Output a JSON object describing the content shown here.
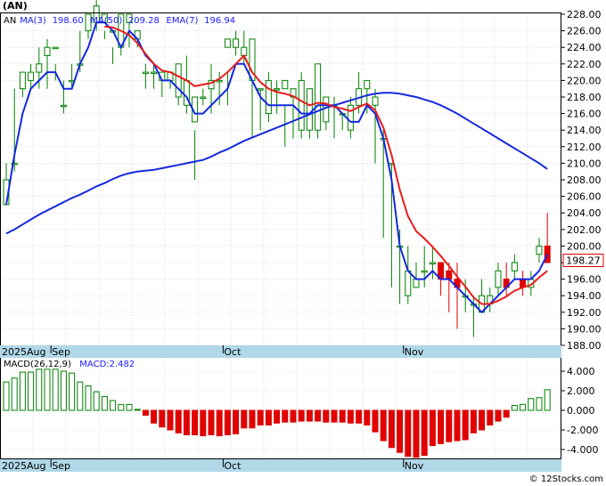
{
  "header": {
    "title": "(AN)",
    "legend": [
      {
        "label": "AN",
        "color": "#000000"
      },
      {
        "label": "MA(3)",
        "color": "#1a1aff"
      },
      {
        "label": "198.60",
        "color": "#1a1aff"
      },
      {
        "label": "MA(50)",
        "color": "#1a1aff"
      },
      {
        "label": "209.28",
        "color": "#1a1aff"
      },
      {
        "label": "EMA(7)",
        "color": "#1a1aff"
      },
      {
        "label": "196.94",
        "color": "#1a1aff"
      }
    ]
  },
  "macd_header": {
    "legend": [
      {
        "label": "MACD(26,12,9)",
        "color": "#000000"
      },
      {
        "label": "MACD:2.482",
        "color": "#1a1aff"
      }
    ]
  },
  "footer": {
    "credit": "© 12Stocks.com"
  },
  "colors": {
    "background": "#ffffff",
    "grid": "#c8c8c8",
    "up": "#008000",
    "down": "#e00000",
    "ma_line": "#1428e0",
    "ema_line": "#e81c1c",
    "axis_band": "#b0d8e8",
    "price_tag_border": "#e00000"
  },
  "chart_data": [
    {
      "type": "candlestick",
      "title": "(AN)",
      "ylim": [
        187,
        230
      ],
      "yticks": [
        188,
        190,
        192,
        194,
        196,
        198,
        200,
        202,
        204,
        206,
        208,
        210,
        212,
        214,
        216,
        218,
        220,
        222,
        224,
        226,
        228
      ],
      "ytick_labels": [
        "188.00",
        "190.00",
        "192.00",
        "194.00",
        "196.00",
        "198.00",
        "200.00",
        "202.00",
        "204.00",
        "206.00",
        "208.00",
        "210.00",
        "212.00",
        "214.00",
        "216.00",
        "218.00",
        "220.00",
        "222.00",
        "224.00",
        "226.00",
        "228.00"
      ],
      "x_labels": [
        {
          "label": "2025Aug",
          "index": 0
        },
        {
          "label": "Sep",
          "index": 6
        },
        {
          "label": "Oct",
          "index": 27
        },
        {
          "label": "Nov",
          "index": 49
        }
      ],
      "last_price": "198.27",
      "ohlc": [
        [
          205,
          208,
          207,
          210
        ],
        [
          210,
          210,
          209,
          219
        ],
        [
          219,
          221,
          218,
          221
        ],
        [
          220,
          221,
          219,
          222
        ],
        [
          221,
          222,
          219,
          224
        ],
        [
          223,
          224,
          219,
          225
        ],
        [
          224,
          224,
          220,
          222
        ],
        [
          217,
          217,
          216,
          220
        ],
        [
          220,
          220,
          219,
          222
        ],
        [
          222,
          222,
          221,
          226
        ],
        [
          226,
          228,
          225,
          228
        ],
        [
          227,
          229,
          226,
          230
        ],
        [
          227,
          228,
          225,
          226
        ],
        [
          226,
          226,
          222,
          224
        ],
        [
          224,
          228,
          223,
          225
        ],
        [
          227,
          228,
          224,
          228
        ],
        [
          225,
          226,
          224,
          226
        ],
        [
          221,
          221,
          219,
          222
        ],
        [
          221,
          221,
          219,
          222
        ],
        [
          220,
          221,
          218,
          221
        ],
        [
          220,
          221,
          219,
          221
        ],
        [
          218,
          222,
          217,
          221
        ],
        [
          217,
          220,
          216,
          223
        ],
        [
          215,
          218,
          208,
          214
        ],
        [
          218,
          218,
          217,
          219
        ],
        [
          219,
          220,
          216,
          222
        ],
        [
          220,
          220,
          217,
          221
        ],
        [
          224,
          225,
          217,
          221
        ],
        [
          224,
          225,
          223,
          226
        ],
        [
          223,
          224,
          222,
          226
        ],
        [
          220,
          225,
          213,
          220
        ],
        [
          219,
          219,
          214,
          219
        ],
        [
          216,
          220,
          215,
          221
        ],
        [
          219,
          219,
          216,
          220
        ],
        [
          219,
          220,
          212,
          217
        ],
        [
          218,
          219,
          213,
          219
        ],
        [
          214,
          220,
          213,
          221
        ],
        [
          214,
          219,
          213,
          219
        ],
        [
          214,
          222,
          213,
          222
        ],
        [
          215,
          218,
          214,
          217
        ],
        [
          217,
          217,
          213,
          218
        ],
        [
          216,
          216,
          214,
          216
        ],
        [
          214,
          217,
          213,
          218
        ],
        [
          217,
          219,
          216,
          221
        ],
        [
          219,
          220,
          216,
          220
        ],
        [
          217,
          218,
          210,
          219
        ],
        [
          213,
          213,
          201,
          214
        ],
        [
          210,
          210,
          195,
          210
        ],
        [
          200,
          200,
          193,
          202
        ],
        [
          194,
          197,
          193,
          200
        ],
        [
          195,
          196,
          195,
          198
        ],
        [
          197,
          197,
          195,
          200
        ],
        [
          198,
          198,
          196,
          200
        ],
        [
          198,
          196,
          194,
          198
        ],
        [
          197,
          196,
          192,
          198
        ],
        [
          196,
          195,
          190,
          198
        ],
        [
          194,
          194,
          192,
          196
        ],
        [
          193,
          193,
          189,
          194
        ],
        [
          192,
          194,
          192,
          196
        ],
        [
          193,
          194,
          192,
          195
        ],
        [
          195,
          197,
          194,
          198
        ],
        [
          196,
          195,
          194,
          198
        ],
        [
          197,
          198,
          196,
          199
        ],
        [
          196,
          195,
          194,
          197
        ],
        [
          195,
          196,
          194,
          197
        ],
        [
          199,
          200,
          198,
          201
        ],
        [
          200,
          198,
          198,
          204
        ]
      ],
      "series": [
        {
          "name": "MA(3)",
          "color": "#1428e0",
          "values": [
            205,
            211,
            216,
            219,
            220,
            221,
            221,
            219,
            219,
            222,
            224,
            227,
            227,
            226,
            224,
            226,
            225,
            223,
            222,
            220,
            220,
            219,
            218,
            216,
            216,
            217,
            218,
            219,
            222,
            222,
            220,
            218,
            217,
            217,
            217,
            217,
            216,
            216,
            217,
            217,
            217,
            216,
            215,
            215,
            217,
            216,
            213,
            208,
            200,
            197,
            196,
            196,
            197,
            196,
            196,
            195,
            194,
            193,
            192,
            193,
            194,
            195,
            196,
            196,
            196,
            197,
            199
          ]
        },
        {
          "name": "MA(50)",
          "color": "#1428e0",
          "values": [
            201.5,
            202,
            202.6,
            203.2,
            203.8,
            204.3,
            204.8,
            205.3,
            205.8,
            206.2,
            206.7,
            207.2,
            207.6,
            208.1,
            208.5,
            208.8,
            209,
            209.1,
            209.2,
            209.4,
            209.6,
            209.8,
            210,
            210.2,
            210.4,
            210.8,
            211.3,
            211.7,
            212.2,
            212.7,
            213.1,
            213.5,
            213.9,
            214.3,
            214.7,
            215.1,
            215.5,
            215.9,
            216.3,
            216.7,
            217,
            217.3,
            217.6,
            217.9,
            218.2,
            218.4,
            218.5,
            218.5,
            218.4,
            218.2,
            218,
            217.7,
            217.4,
            217,
            216.5,
            216,
            215.4,
            214.8,
            214.2,
            213.6,
            213,
            212.4,
            211.8,
            211.2,
            210.6,
            210,
            209.3
          ]
        },
        {
          "name": "EMA(7)",
          "color": "#e81c1c",
          "values": [
            null,
            null,
            null,
            null,
            null,
            null,
            null,
            null,
            null,
            null,
            null,
            null,
            226.5,
            226.4,
            226,
            225.5,
            224.5,
            223.2,
            222,
            221.2,
            221,
            220.5,
            220,
            219.3,
            219.5,
            219.7,
            220.2,
            221,
            222,
            223,
            221,
            219.8,
            219,
            218.6,
            218.4,
            218.1,
            217.5,
            217,
            217.3,
            217.2,
            216.8,
            216.6,
            216.3,
            216.8,
            217.2,
            216.4,
            214.3,
            211,
            206.8,
            203.6,
            201.8,
            200.9,
            199.9,
            198.8,
            197.6,
            196.3,
            195.1,
            193.8,
            193,
            193,
            193.4,
            193.9,
            194.6,
            195,
            195.3,
            196.2,
            197
          ]
        }
      ]
    },
    {
      "type": "bar",
      "title": "MACD(26,12,9)",
      "ylim": [
        -5,
        5
      ],
      "yticks": [
        -4,
        -2,
        0,
        2,
        4
      ],
      "ytick_labels": [
        "-4.000",
        "-2.000",
        "0.000",
        "2.000",
        "4.000"
      ],
      "x_labels": [
        {
          "label": "2025Aug",
          "index": 0
        },
        {
          "label": "Sep",
          "index": 6
        },
        {
          "label": "Oct",
          "index": 27
        },
        {
          "label": "Nov",
          "index": 49
        }
      ],
      "values": [
        2.9,
        3.3,
        3.9,
        3.9,
        4.2,
        4.2,
        4.2,
        4,
        3.8,
        2.9,
        2.5,
        1.9,
        1.4,
        1,
        0.6,
        0.6,
        0.1,
        -0.5,
        -1.3,
        -1.7,
        -2,
        -2.3,
        -2.5,
        -2.5,
        -2.6,
        -2.5,
        -2.6,
        -2.5,
        -2.4,
        -1.8,
        -1.8,
        -1.5,
        -1.5,
        -1.3,
        -1.2,
        -1.2,
        -1.1,
        -1.1,
        -1.1,
        -1.2,
        -1.2,
        -1.2,
        -1.3,
        -1.3,
        -1.5,
        -2.2,
        -3.1,
        -3.8,
        -4.3,
        -4.7,
        -4.8,
        -4.6,
        -3.6,
        -3.4,
        -3.2,
        -3.1,
        -3,
        -2.3,
        -2,
        -1.5,
        -1.1,
        -0.7,
        0.5,
        0.6,
        1.2,
        1.3,
        2.1
      ]
    }
  ]
}
